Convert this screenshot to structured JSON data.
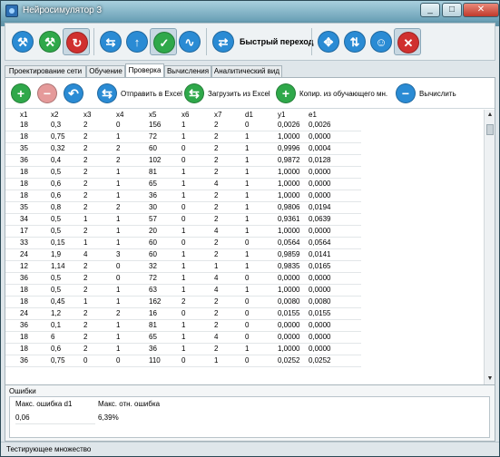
{
  "window": {
    "title": "Нейросимулятор 3",
    "min": "_",
    "max": "□",
    "close": "✕"
  },
  "toolbar": {
    "quick_label": "Быстрый переход",
    "buttons": [
      {
        "name": "wrench-icon",
        "glyph": "⚒",
        "color": "#2a8bd4"
      },
      {
        "name": "tools-green-icon",
        "glyph": "⚒",
        "color": "#2fa84a"
      },
      {
        "name": "refresh-red-icon",
        "glyph": "↻",
        "color": "#d0302f"
      },
      {
        "name": "arrows-icon",
        "glyph": "⇆",
        "color": "#2a8bd4"
      },
      {
        "name": "up-arrow-icon",
        "glyph": "↑",
        "color": "#2a8bd4"
      },
      {
        "name": "check-icon",
        "glyph": "✓",
        "color": "#2fa84a"
      },
      {
        "name": "wave-icon",
        "glyph": "∿",
        "color": "#2a8bd4"
      },
      {
        "name": "quick-jump-icon",
        "glyph": "⇄",
        "color": "#2a8bd4"
      },
      {
        "name": "move-icon",
        "glyph": "✥",
        "color": "#2a8bd4"
      },
      {
        "name": "sort-icon",
        "glyph": "⇅",
        "color": "#2a8bd4"
      },
      {
        "name": "user-icon",
        "glyph": "☺",
        "color": "#2a8bd4"
      },
      {
        "name": "close-red-icon",
        "glyph": "✕",
        "color": "#d0302f"
      }
    ]
  },
  "tabs": [
    "Проектирование сети",
    "Обучение",
    "Проверка",
    "Вычисления",
    "Аналитический вид"
  ],
  "actions": {
    "send_excel": "Отправить в Excel",
    "load_excel": "Загрузить из Excel",
    "copy_train": "Копир. из обучающего мн.",
    "compute": "Вычислить"
  },
  "table": {
    "headers": [
      "x1",
      "x2",
      "x3",
      "x4",
      "x5",
      "x6",
      "x7",
      "d1",
      "y1",
      "e1"
    ],
    "rows": [
      [
        "18",
        "0,3",
        "2",
        "0",
        "156",
        "1",
        "2",
        "0",
        "0,0026",
        "0,0026"
      ],
      [
        "18",
        "0,75",
        "2",
        "1",
        "72",
        "1",
        "2",
        "1",
        "1,0000",
        "0,0000"
      ],
      [
        "35",
        "0,32",
        "2",
        "2",
        "60",
        "0",
        "2",
        "1",
        "0,9996",
        "0,0004"
      ],
      [
        "36",
        "0,4",
        "2",
        "2",
        "102",
        "0",
        "2",
        "1",
        "0,9872",
        "0,0128"
      ],
      [
        "18",
        "0,5",
        "2",
        "1",
        "81",
        "1",
        "2",
        "1",
        "1,0000",
        "0,0000"
      ],
      [
        "18",
        "0,6",
        "2",
        "1",
        "65",
        "1",
        "4",
        "1",
        "1,0000",
        "0,0000"
      ],
      [
        "18",
        "0,6",
        "2",
        "1",
        "36",
        "1",
        "2",
        "1",
        "1,0000",
        "0,0000"
      ],
      [
        "35",
        "0,8",
        "2",
        "2",
        "30",
        "0",
        "2",
        "1",
        "0,9806",
        "0,0194"
      ],
      [
        "34",
        "0,5",
        "1",
        "1",
        "57",
        "0",
        "2",
        "1",
        "0,9361",
        "0,0639"
      ],
      [
        "17",
        "0,5",
        "2",
        "1",
        "20",
        "1",
        "4",
        "1",
        "1,0000",
        "0,0000"
      ],
      [
        "33",
        "0,15",
        "1",
        "1",
        "60",
        "0",
        "2",
        "0",
        "0,0564",
        "0,0564"
      ],
      [
        "24",
        "1,9",
        "4",
        "3",
        "60",
        "1",
        "2",
        "1",
        "0,9859",
        "0,0141"
      ],
      [
        "12",
        "1,14",
        "2",
        "0",
        "32",
        "1",
        "1",
        "1",
        "0,9835",
        "0,0165"
      ],
      [
        "36",
        "0,5",
        "2",
        "0",
        "72",
        "1",
        "4",
        "0",
        "0,0000",
        "0,0000"
      ],
      [
        "18",
        "0,5",
        "2",
        "1",
        "63",
        "1",
        "4",
        "1",
        "1,0000",
        "0,0000"
      ],
      [
        "18",
        "0,45",
        "1",
        "1",
        "162",
        "2",
        "2",
        "0",
        "0,0080",
        "0,0080"
      ],
      [
        "24",
        "1,2",
        "2",
        "2",
        "16",
        "0",
        "2",
        "0",
        "0,0155",
        "0,0155"
      ],
      [
        "36",
        "0,1",
        "2",
        "1",
        "81",
        "1",
        "2",
        "0",
        "0,0000",
        "0,0000"
      ],
      [
        "18",
        "6",
        "2",
        "1",
        "65",
        "1",
        "4",
        "0",
        "0,0000",
        "0,0000"
      ],
      [
        "18",
        "0,6",
        "2",
        "1",
        "36",
        "1",
        "2",
        "1",
        "1,0000",
        "0,0000"
      ],
      [
        "36",
        "0,75",
        "0",
        "0",
        "110",
        "0",
        "1",
        "0",
        "0,0252",
        "0,0252"
      ]
    ]
  },
  "errors": {
    "title": "Ошибки",
    "max_error_label": "Макс. ошибка d1",
    "max_rel_error_label": "Макс. отн. ошибка",
    "max_error_value": "0,06",
    "max_rel_error_value": "6,39%"
  },
  "status": "Тестирующее множество"
}
